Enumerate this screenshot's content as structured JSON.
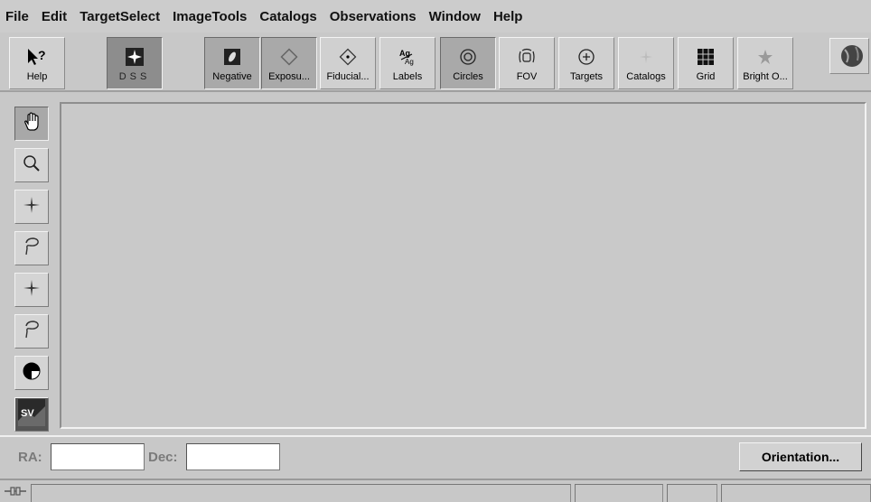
{
  "menubar": {
    "items": [
      "File",
      "Edit",
      "TargetSelect",
      "ImageTools",
      "Catalogs",
      "Observations",
      "Window",
      "Help"
    ]
  },
  "toolbar": {
    "help_label": "Help",
    "dss_label": "DSS",
    "negative_label": "Negative",
    "exposure_label": "Exposu...",
    "fiducial_label": "Fiducial...",
    "labels_label": "Labels",
    "circles_label": "Circles",
    "fov_label": "FOV",
    "targets_label": "Targets",
    "catalogs_label": "Catalogs",
    "grid_label": "Grid",
    "brightobj_label": "Bright O..."
  },
  "tools": {
    "sv_label": "SV"
  },
  "coords": {
    "ra_label": "RA:",
    "ra_value": "",
    "dec_label": "Dec:",
    "dec_value": "",
    "orientation_label": "Orientation..."
  },
  "colors": {
    "background": "#c8c8c8",
    "pressed": "#a9a9a9",
    "dss_bg": "#8d8d8d"
  }
}
